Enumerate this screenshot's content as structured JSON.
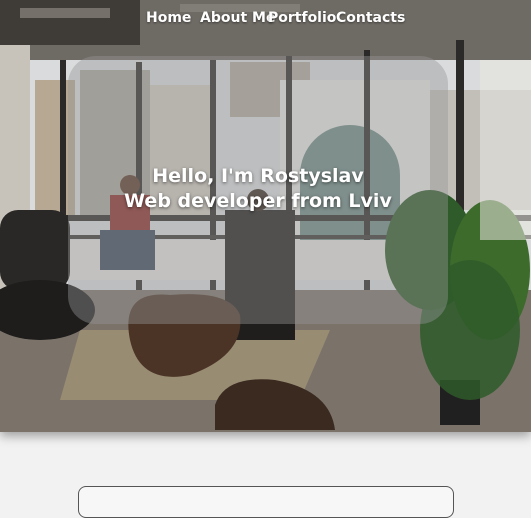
{
  "nav": {
    "home": "Home",
    "about": "About Me",
    "portfolio": "Portfolio",
    "contacts": "Contacts"
  },
  "hero": {
    "greeting": "Hello, I'm Rostyslav",
    "subtitle": "Web developer from Lviv",
    "overlay_color": "#969696"
  }
}
